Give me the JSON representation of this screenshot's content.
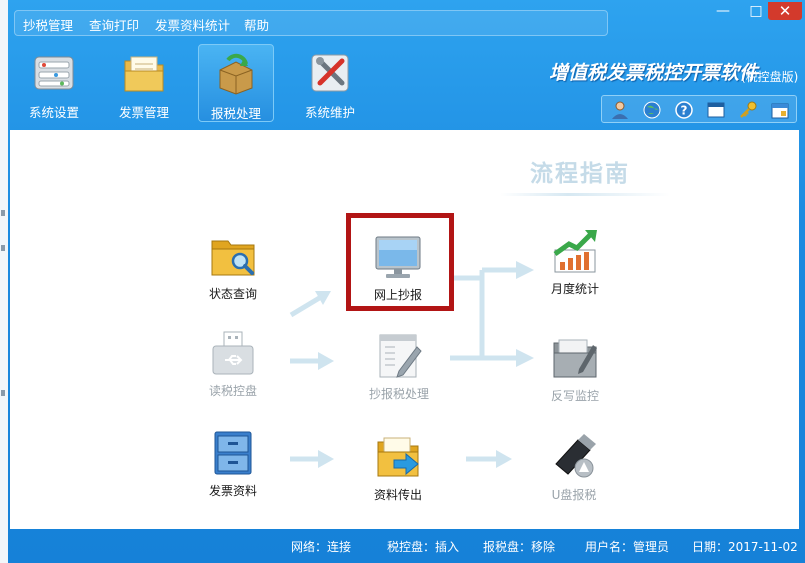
{
  "menu": [
    "抄税管理",
    "查询打印",
    "发票资料统计",
    "帮助"
  ],
  "window_controls": {
    "minimize": "—",
    "maximize": "□",
    "close": "✕"
  },
  "toolbar": [
    {
      "label": "系统设置",
      "icon": "settings-panel-icon"
    },
    {
      "label": "发票管理",
      "icon": "invoice-folder-icon"
    },
    {
      "label": "报税处理",
      "icon": "tax-report-box-icon"
    },
    {
      "label": "系统维护",
      "icon": "maintenance-tools-icon"
    }
  ],
  "toolbar_active": "报税处理",
  "brand": {
    "title": "增值税发票税控开票软件",
    "subtitle": "(税控盘版)"
  },
  "tools": [
    "user-icon",
    "globe-icon",
    "help-icon",
    "window-icon",
    "key-icon",
    "calendar-icon"
  ],
  "guide_title": "流程指南",
  "flow": {
    "status_query": "状态查询",
    "online_report": "网上抄报",
    "monthly_stats": "月度统计",
    "read_tax_disk": "读税控盘",
    "report_process": "抄报税处理",
    "write_back": "反写监控",
    "invoice_data": "发票资料",
    "data_export": "资料传出",
    "usb_report": "U盘报税"
  },
  "status": {
    "network": "网络：连接",
    "tax_disk": "税控盘：插入",
    "report_disk": "报税盘：移除",
    "user": "用户名：管理员",
    "date": "日期：2017-11-02"
  },
  "colors": {
    "accent": "#1b8ae0",
    "highlight": "#b21515",
    "arrow": "#cfe4ef"
  }
}
